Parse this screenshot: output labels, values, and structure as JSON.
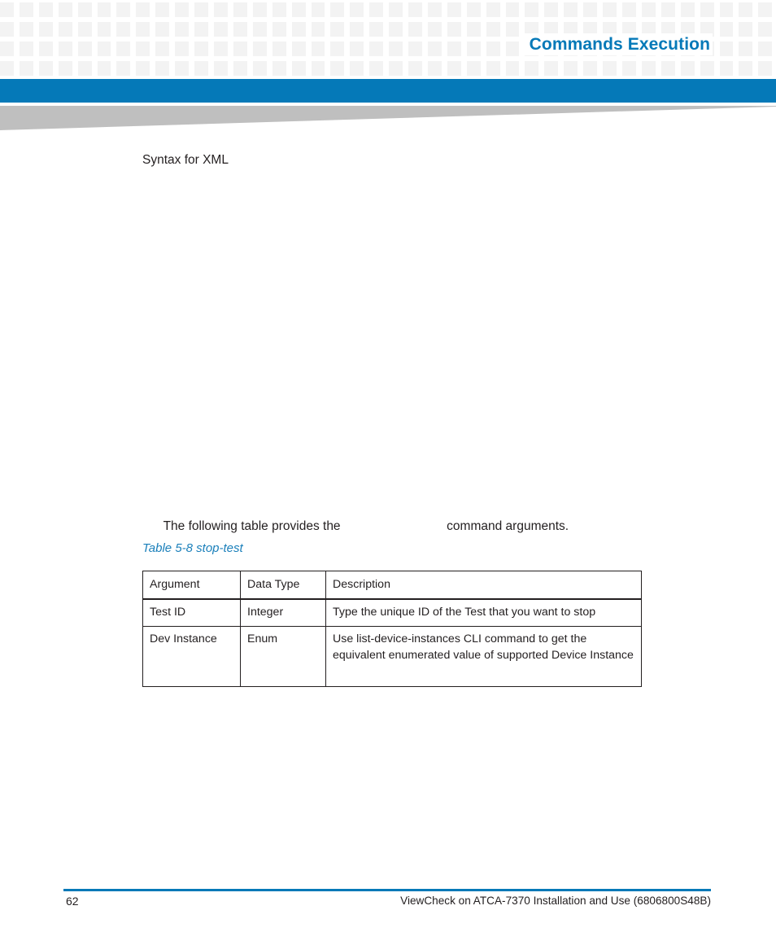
{
  "header": {
    "title": "Commands Execution",
    "accent_color": "#0579b8",
    "grid_square_color": "#f3f3f3",
    "wedge_color": "#bfbfbf"
  },
  "body": {
    "syntax_line": "Syntax for XML",
    "following_prefix": "The following table provides the ",
    "following_suffix": " command arguments.",
    "table_caption": "Table 5-8 stop-test"
  },
  "table": {
    "headers": [
      "Argument",
      "Data Type",
      "Description"
    ],
    "rows": [
      {
        "argument": "Test ID",
        "data_type": "Integer",
        "description": "Type the unique ID of the Test that you want to stop"
      },
      {
        "argument": "Dev Instance",
        "data_type": "Enum",
        "description": "Use list-device-instances CLI command to get the equivalent enumerated value of supported Device Instance"
      }
    ]
  },
  "footer": {
    "page_number": "62",
    "document_title": "ViewCheck on ATCA-7370 Installation and Use (6806800S48B)",
    "rule_color": "#0579b8"
  }
}
